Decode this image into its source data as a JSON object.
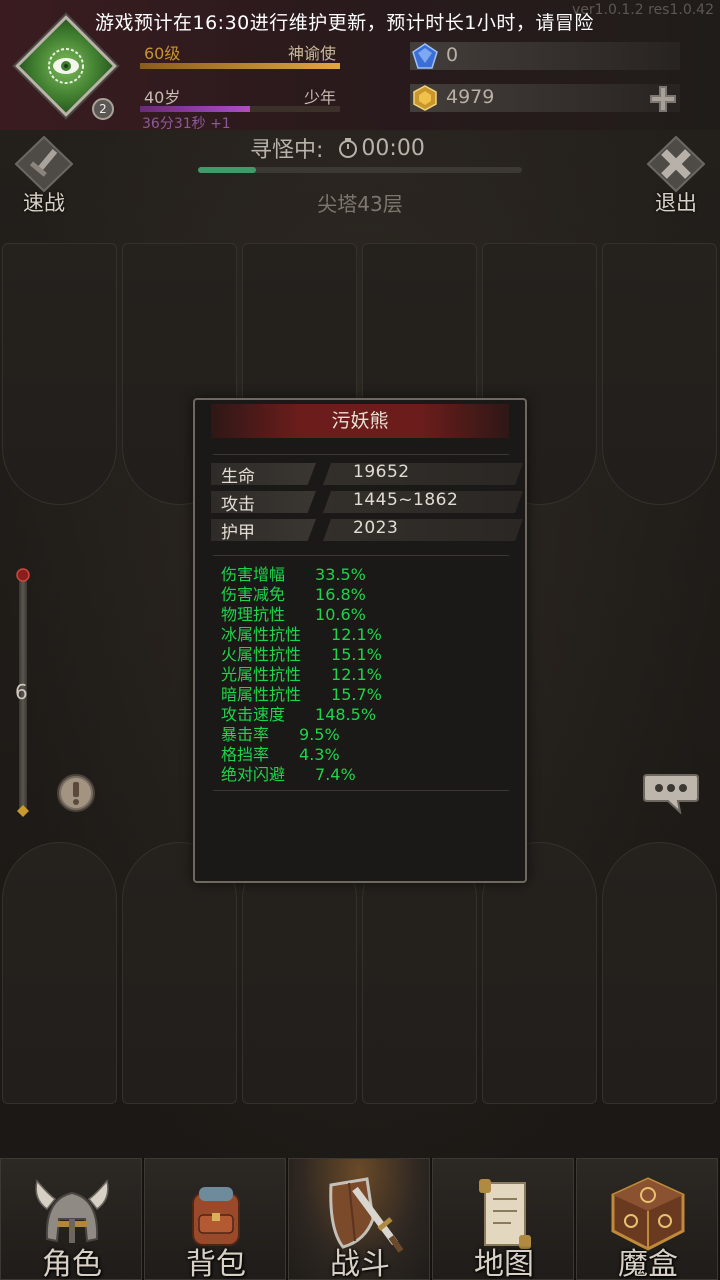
{
  "notice": "游戏预计在16:30进行维护更新，预计时长1小时，请冒险",
  "version_text": "ver1.0.1.2 res1.0.42",
  "player": {
    "avatar_badge": "2",
    "level": "60级",
    "class": "神谕使",
    "age": "40岁",
    "age_stage": "少年",
    "age_timer": "36分31秒 +1",
    "level_progress": 1.0,
    "age_progress": 0.55
  },
  "resources": {
    "diamond": "0",
    "gold": "4979"
  },
  "battle": {
    "quick_battle": "速战",
    "exit": "退出",
    "status": "寻怪中:",
    "timer": "00:00",
    "progress": 0.18,
    "floor": "尖塔43层",
    "side_counter": "6"
  },
  "monster": {
    "name": "污妖熊",
    "basic": [
      {
        "k": "生命",
        "v": "19652"
      },
      {
        "k": "攻击",
        "v": "1445~1862"
      },
      {
        "k": "护甲",
        "v": "2023"
      }
    ],
    "stats": [
      {
        "k": "伤害增幅",
        "v": "33.5%"
      },
      {
        "k": "伤害减免",
        "v": "16.8%"
      },
      {
        "k": "物理抗性",
        "v": "10.6%"
      },
      {
        "k": "冰属性抗性",
        "v": "12.1%"
      },
      {
        "k": "火属性抗性",
        "v": "15.1%"
      },
      {
        "k": "光属性抗性",
        "v": "12.1%"
      },
      {
        "k": "暗属性抗性",
        "v": "15.7%"
      },
      {
        "k": "攻击速度",
        "v": "148.5%"
      },
      {
        "k": "暴击率",
        "v": "9.5%"
      },
      {
        "k": "格挡率",
        "v": "4.3%"
      },
      {
        "k": "绝对闪避",
        "v": "7.4%"
      }
    ]
  },
  "nav": [
    {
      "label": "角色",
      "icon": "helmet-icon"
    },
    {
      "label": "背包",
      "icon": "backpack-icon"
    },
    {
      "label": "战斗",
      "icon": "sword-shield-icon",
      "active": true
    },
    {
      "label": "地图",
      "icon": "scroll-map-icon"
    },
    {
      "label": "魔盒",
      "icon": "magic-box-icon"
    }
  ],
  "colors": {
    "stat_green": "#1fd34a",
    "title_red": "#6c1d1b",
    "level_bar": "#c9922e",
    "age_bar": "#a040b0",
    "progress_green": "#3f9b6a"
  }
}
